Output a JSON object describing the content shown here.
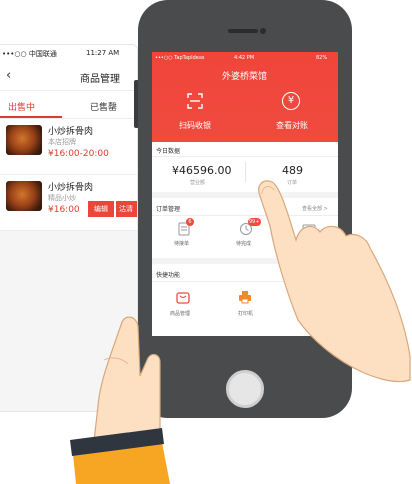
{
  "back_phone": {
    "status": {
      "carrier": "•••○○ 中国联通",
      "time": "11:27 AM"
    },
    "nav": {
      "back_icon": "chevron-left-icon",
      "title": "商品管理"
    },
    "tabs": [
      {
        "label": "出售中",
        "active": true
      },
      {
        "label": "已售罄",
        "active": false
      }
    ],
    "products": [
      {
        "name": "小炒拆骨肉",
        "subtitle": "本店招牌",
        "price": "¥16:00-20:00"
      },
      {
        "name": "小炒拆骨肉",
        "subtitle": "精品小炒",
        "price": "¥16:00",
        "actions": [
          "编辑",
          "沽清"
        ]
      }
    ]
  },
  "front_phone": {
    "status": {
      "carrier": "•••○○ TapTapIdeas",
      "time": "4:42 PM",
      "battery": "82%"
    },
    "shop_name": "外婆桥菜馆",
    "actions": [
      {
        "label": "扫码收银",
        "icon": "scan-icon"
      },
      {
        "label": "查看对账",
        "icon": "yen-icon"
      }
    ],
    "today": {
      "title": "今日数据",
      "revenue_value": "¥46596.00",
      "revenue_label": "营业额",
      "orders_value": "489",
      "orders_label": "订单"
    },
    "orders": {
      "title": "订单管理",
      "more": "查看全部 >",
      "items": [
        {
          "label": "待接单",
          "badge": "6",
          "icon": "order-icon"
        },
        {
          "label": "待完成",
          "badge": "99+",
          "icon": "clock-icon"
        },
        {
          "label": "",
          "badge": "",
          "icon": "refund-icon"
        }
      ]
    },
    "quick": {
      "title": "快捷功能",
      "items": [
        {
          "label": "商品管理",
          "icon": "bag-icon"
        },
        {
          "label": "打印机",
          "icon": "printer-icon"
        }
      ]
    }
  },
  "colors": {
    "brand_red": "#ef4b3e",
    "phone_body": "#4a4b4d",
    "hand_skin": "#fde0c2",
    "cuff": "#f6a623"
  }
}
